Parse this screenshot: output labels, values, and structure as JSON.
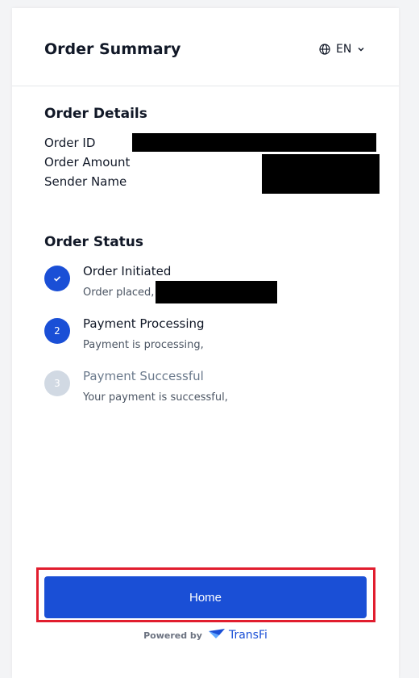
{
  "header": {
    "title": "Order Summary",
    "language": "EN"
  },
  "order_details": {
    "title": "Order Details",
    "labels": {
      "order_id": "Order ID",
      "order_amount": "Order Amount",
      "sender_name": "Sender Name"
    }
  },
  "order_status": {
    "title": "Order Status",
    "steps": [
      {
        "marker": "✓",
        "title": "Order Initiated",
        "subtitle": "Order placed,",
        "state": "complete"
      },
      {
        "marker": "2",
        "title": "Payment Processing",
        "subtitle": "Payment is processing,",
        "state": "active"
      },
      {
        "marker": "3",
        "title": "Payment Successful",
        "subtitle": "Your payment is successful,",
        "state": "pending"
      }
    ]
  },
  "actions": {
    "home_label": "Home"
  },
  "footer": {
    "powered_by": "Powered by",
    "brand": "TransFi"
  },
  "colors": {
    "primary": "#1a4fd6",
    "highlight_border": "#e11d2e",
    "pending_circle": "#d1d9e3",
    "pending_text": "#6b7a8c"
  }
}
